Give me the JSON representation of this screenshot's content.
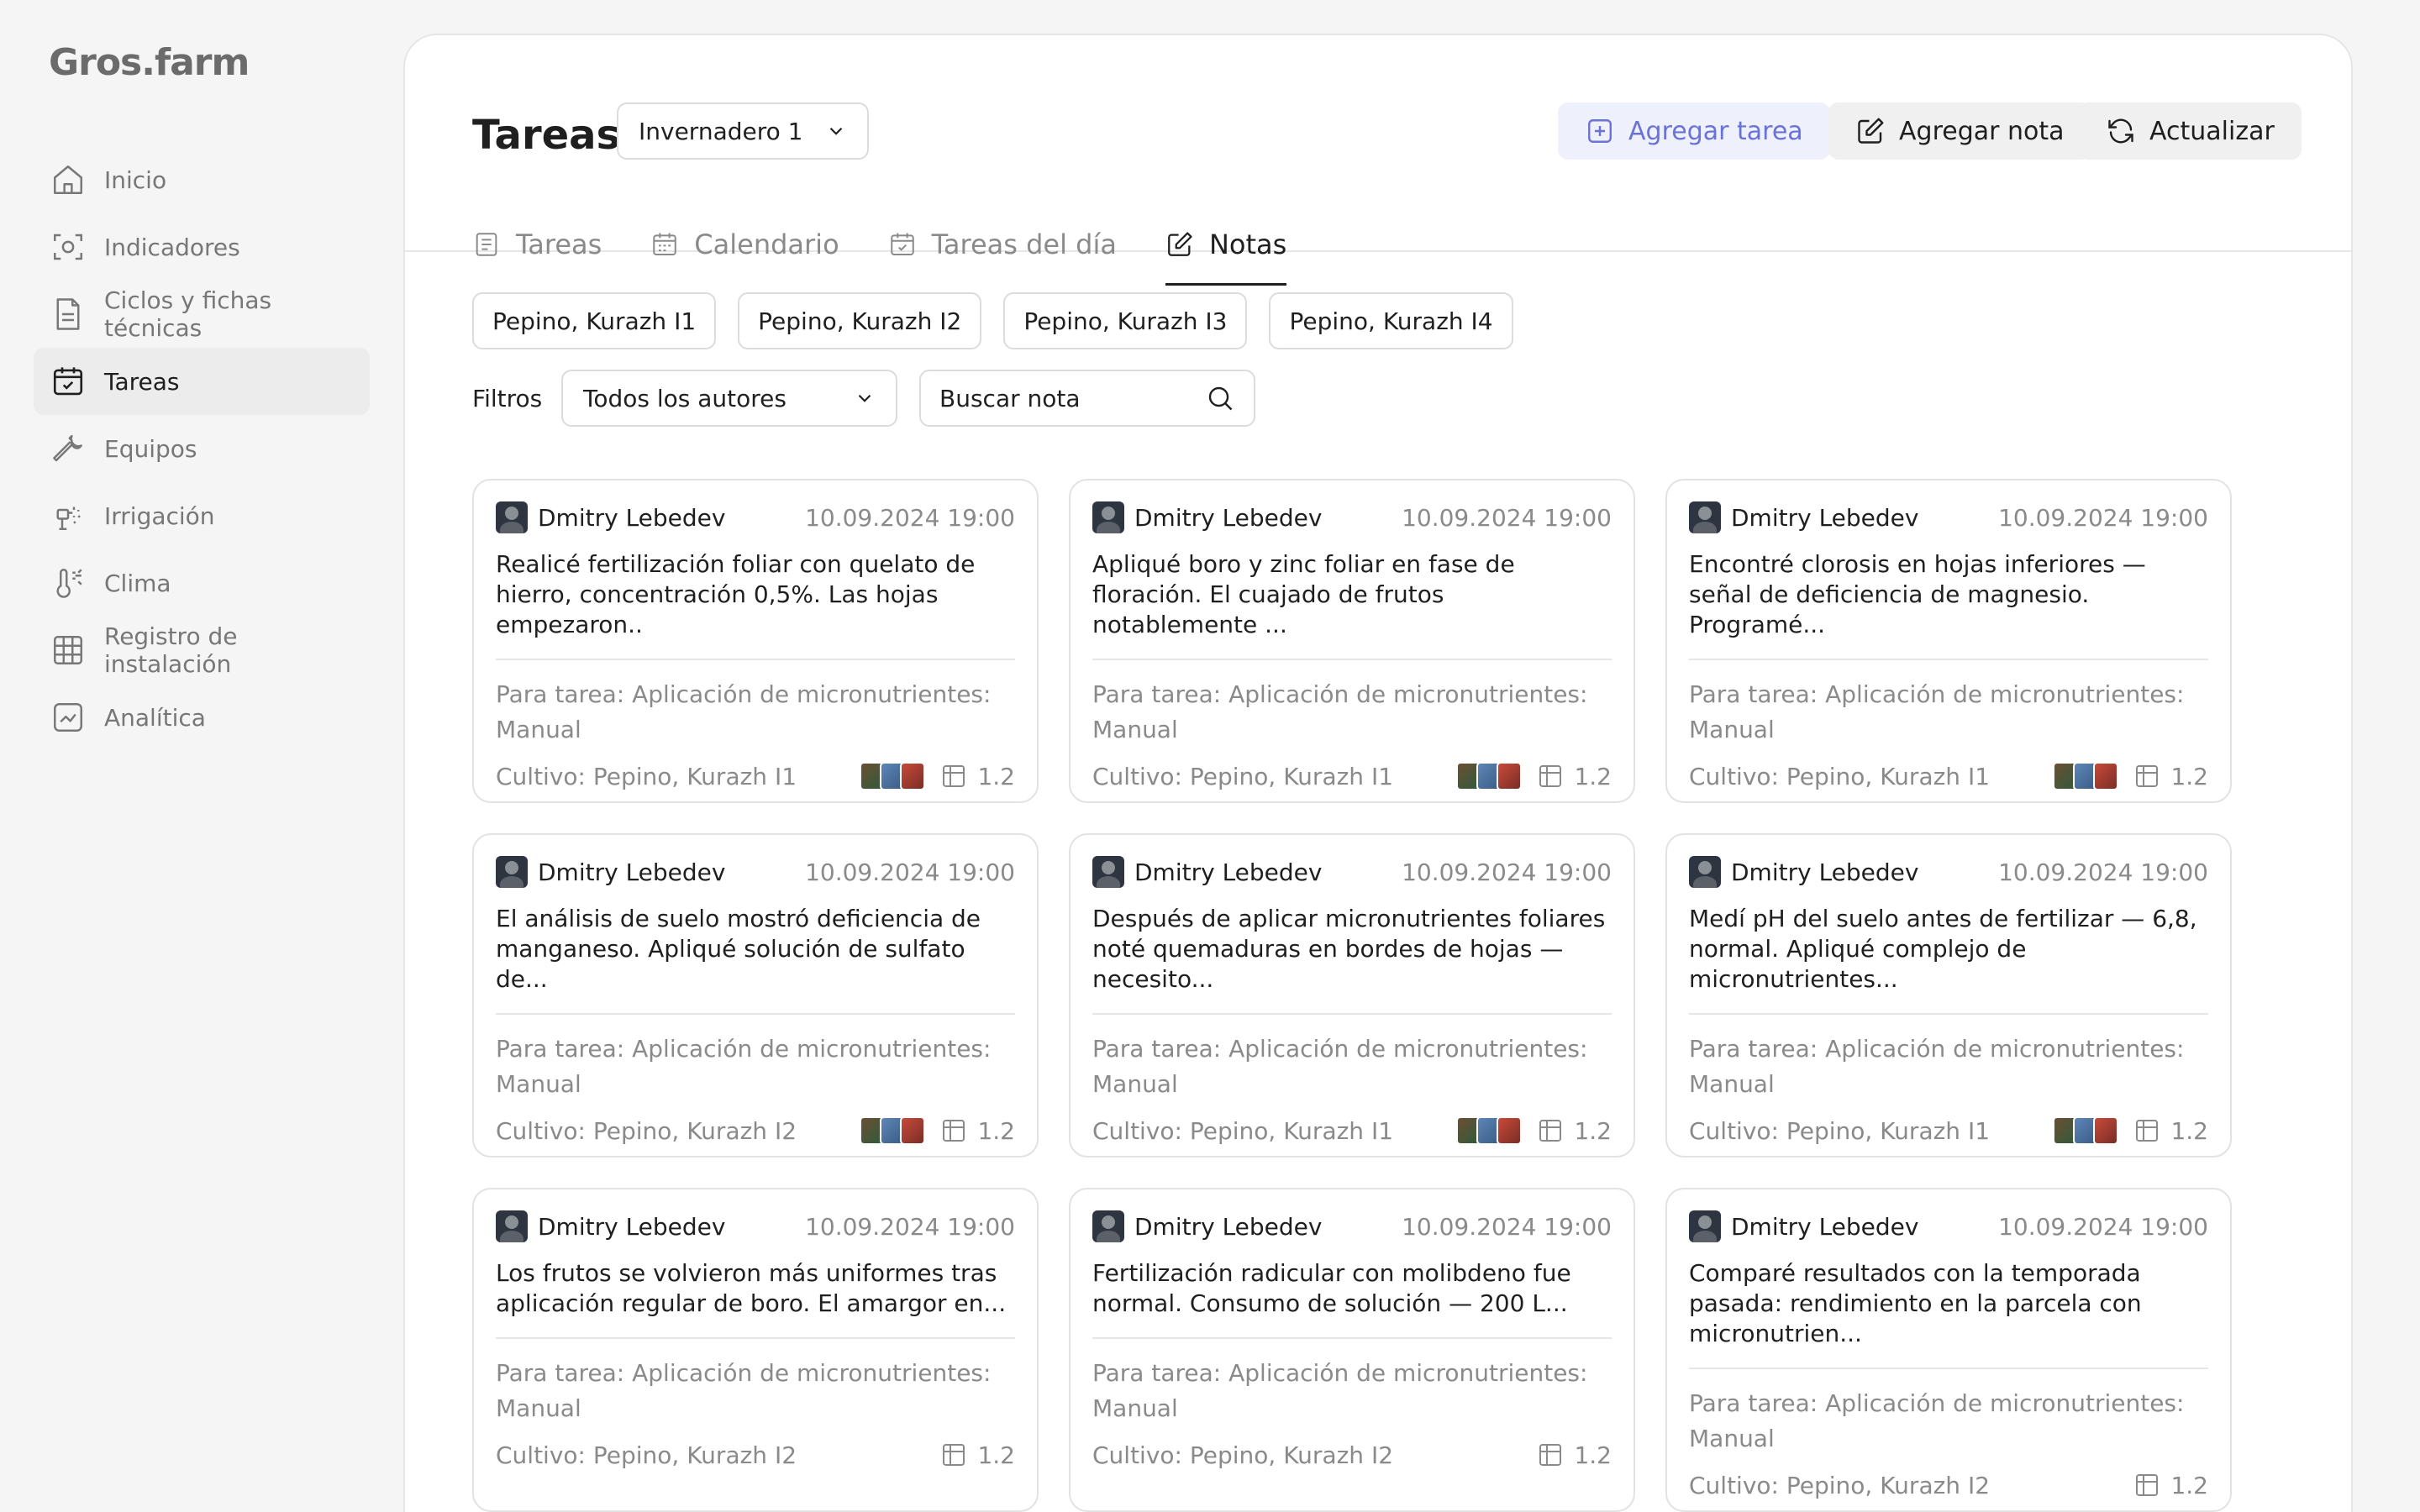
{
  "app": {
    "logo": "Gros.farm"
  },
  "sidebar": {
    "items": [
      {
        "label": "Inicio",
        "icon": "home-icon",
        "active": false
      },
      {
        "label": "Indicadores",
        "icon": "scan-icon",
        "active": false
      },
      {
        "label": "Ciclos y fichas técnicas",
        "icon": "document-icon",
        "active": false
      },
      {
        "label": "Tareas",
        "icon": "calendar-check-icon",
        "active": true
      },
      {
        "label": "Equipos",
        "icon": "wrench-icon",
        "active": false
      },
      {
        "label": "Irrigación",
        "icon": "sprinkler-icon",
        "active": false
      },
      {
        "label": "Clima",
        "icon": "thermometer-icon",
        "active": false
      },
      {
        "label": "Registro de instalación",
        "icon": "grid-icon",
        "active": false
      },
      {
        "label": "Analítica",
        "icon": "chart-icon",
        "active": false
      }
    ]
  },
  "header": {
    "title": "Tareas",
    "greenhouse": "Invernadero 1",
    "add_task": "Agregar tarea",
    "add_note": "Agregar nota",
    "refresh": "Actualizar"
  },
  "tabs": [
    {
      "label": "Tareas",
      "active": false
    },
    {
      "label": "Calendario",
      "active": false
    },
    {
      "label": "Tareas del día",
      "active": false
    },
    {
      "label": "Notas",
      "active": true
    }
  ],
  "chips": [
    "Pepino, Kurazh I1",
    "Pepino, Kurazh I2",
    "Pepino, Kurazh I3",
    "Pepino, Kurazh I4"
  ],
  "filters": {
    "label": "Filtros",
    "authors": "Todos los autores",
    "search_placeholder": "Buscar nota"
  },
  "notes": [
    {
      "author": "Dmitry Lebedev",
      "date": "10.09.2024 19:00",
      "text": "Realicé fertilización foliar con quelato de hierro, concentración 0,5%. Las hojas empezaron..",
      "task": "Para tarea: Aplicación de micronutrientes: Manual",
      "crop": "Cultivo: Pepino, Kurazh I1",
      "count": "1.2",
      "photos": true
    },
    {
      "author": "Dmitry Lebedev",
      "date": "10.09.2024 19:00",
      "text": "Apliqué boro y zinc foliar en fase de floración. El cuajado de frutos notablemente ...",
      "task": "Para tarea: Aplicación de micronutrientes: Manual",
      "crop": "Cultivo: Pepino, Kurazh I1",
      "count": "1.2",
      "photos": true
    },
    {
      "author": "Dmitry Lebedev",
      "date": "10.09.2024 19:00",
      "text": "Encontré clorosis en hojas inferiores — señal de deficiencia de magnesio. Programé...",
      "task": "Para tarea: Aplicación de micronutrientes: Manual",
      "crop": "Cultivo: Pepino, Kurazh I1",
      "count": "1.2",
      "photos": true
    },
    {
      "author": "Dmitry Lebedev",
      "date": "10.09.2024 19:00",
      "text": "El análisis de suelo mostró deficiencia de manganeso. Apliqué solución de sulfato de...",
      "task": "Para tarea: Aplicación de micronutrientes: Manual",
      "crop": "Cultivo: Pepino, Kurazh I2",
      "count": "1.2",
      "photos": true
    },
    {
      "author": "Dmitry Lebedev",
      "date": "10.09.2024 19:00",
      "text": "Después de aplicar micronutrientes foliares noté quemaduras en bordes de hojas — necesito...",
      "task": "Para tarea: Aplicación de micronutrientes: Manual",
      "crop": "Cultivo: Pepino, Kurazh I1",
      "count": "1.2",
      "photos": true
    },
    {
      "author": "Dmitry Lebedev",
      "date": "10.09.2024 19:00",
      "text": "Medí pH del suelo antes de fertilizar — 6,8, normal. Apliqué complejo de micronutrientes...",
      "task": "Para tarea: Aplicación de micronutrientes: Manual",
      "crop": "Cultivo: Pepino, Kurazh I1",
      "count": "1.2",
      "photos": true
    },
    {
      "author": "Dmitry Lebedev",
      "date": "10.09.2024 19:00",
      "text": "Los frutos se volvieron más uniformes tras aplicación regular de boro. El amargor en...",
      "task": "Para tarea: Aplicación de micronutrientes: Manual",
      "crop": "Cultivo: Pepino, Kurazh I2",
      "count": "1.2",
      "photos": false
    },
    {
      "author": "Dmitry Lebedev",
      "date": "10.09.2024 19:00",
      "text": "Fertilización radicular con molibdeno fue normal. Consumo de solución — 200 L...",
      "task": "Para tarea: Aplicación de micronutrientes: Manual",
      "crop": "Cultivo: Pepino, Kurazh I2",
      "count": "1.2",
      "photos": false
    },
    {
      "author": "Dmitry Lebedev",
      "date": "10.09.2024 19:00",
      "text": "Comparé resultados con la temporada pasada: rendimiento en la parcela con micronutrien...",
      "task": "Para tarea: Aplicación de micronutrientes: Manual",
      "crop": "Cultivo: Pepino, Kurazh I2",
      "count": "1.2",
      "photos": false
    }
  ]
}
